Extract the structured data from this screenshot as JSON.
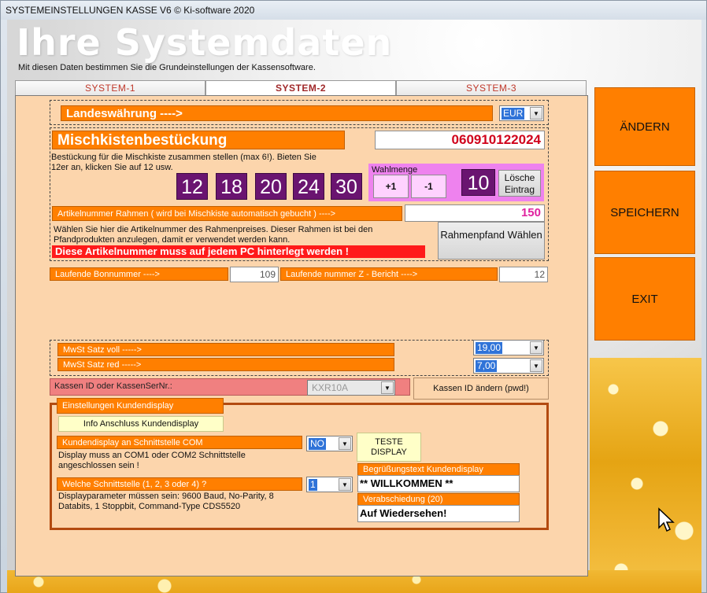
{
  "window": {
    "title": "SYSTEMEINSTELLUNGEN KASSE  V6  © Ki-software 2020"
  },
  "header": {
    "title": "Ihre Systemdaten",
    "subtitle": "Mit diesen Daten bestimmen Sie die Grundeinstellungen der Kassensoftware."
  },
  "tabs": [
    {
      "label": "SYSTEM-1"
    },
    {
      "label": "SYSTEM-2"
    },
    {
      "label": "SYSTEM-3"
    }
  ],
  "currency": {
    "label": "Landeswährung ---->",
    "value": "EUR"
  },
  "mix": {
    "label": "Mischkistenbestückung",
    "code": "060910122024",
    "help": "Bestückung für die Mischkiste zusammen stellen (max 6!). Bieten Sie 12er an, klicken Sie auf 12 usw.",
    "tiles": [
      "12",
      "18",
      "20",
      "24",
      "30"
    ],
    "wahlmenge_label": "Wahlmenge",
    "plus_label": "+1",
    "minus_label": "-1",
    "current": "10",
    "clear_label": "Lösche Eintrag"
  },
  "frame": {
    "label": "Artikelnummer Rahmen ( wird bei Mischkiste automatisch gebucht ) ---->",
    "value": "150",
    "help": "Wählen Sie hier die Artikelnummer des Rahmenpreises. Dieser Rahmen ist bei den Pfandprodukten anzulegen, damit er verwendet werden kann.",
    "warning": "Diese Artikelnummer muss auf jedem PC hinterlegt werden !",
    "button": "Rahmenpfand Wählen"
  },
  "counters": {
    "bon_label": "Laufende Bonnummer ---->",
    "bon_value": "109",
    "z_label": "Laufende nummer Z - Bericht ---->",
    "z_value": "12"
  },
  "vat": {
    "full_label": "MwSt Satz voll ----->",
    "full_value": "19,00",
    "reduced_label": "MwSt Satz red ----->",
    "reduced_value": "7,00"
  },
  "kassen": {
    "label": "Kassen ID oder KassenSerNr.:",
    "value": "KXR10A",
    "button": "Kassen ID ändern (pwd!)"
  },
  "display": {
    "group_label": "Einstellungen Kundendisplay",
    "info_button": "Info  Anschluss  Kundendisplay",
    "com_label": "Kundendisplay an Schnittstelle COM",
    "com_value": "NO",
    "com_help": "Display muss an COM1 oder COM2 Schnittstelle angeschlossen sein !",
    "test_button": "TESTE DISPLAY",
    "port_label": "Welche Schnittstelle (1, 2, 3 oder 4) ?",
    "port_value": "1",
    "port_help": "Displayparameter müssen sein: 9600 Baud, No-Parity, 8 Databits, 1 Stoppbit, Command-Type CDS5520",
    "greeting_label": "Begrüßungstext Kundendisplay",
    "greeting_value": "** WILLKOMMEN **",
    "farewell_label": "Verabschiedung (20)",
    "farewell_value": "Auf Wiedersehen!"
  },
  "side_buttons": {
    "change": "ÄNDERN",
    "save": "SPEICHERN",
    "exit": "EXIT"
  },
  "colors": {
    "accent_orange": "#ff7f00",
    "panel_bg": "#fcd5ac",
    "tile_purple": "#6a1470",
    "code_red": "#d0021b",
    "value_magenta": "#e0229f",
    "warning_red": "#ff1a1a"
  }
}
